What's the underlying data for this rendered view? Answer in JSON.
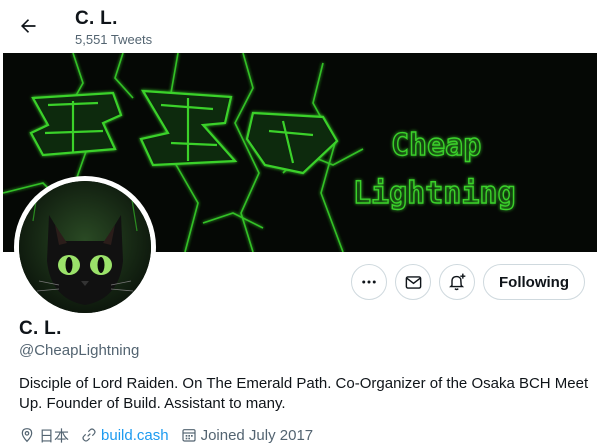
{
  "header": {
    "back_icon": "arrow-left-icon",
    "name": "C. L.",
    "tweet_count": "5,551 Tweets"
  },
  "banner": {
    "text_line1": "Cheap",
    "text_line2": "Lightning",
    "colors": {
      "background": "#050805",
      "lightning": "#39d62a",
      "text": "#3ad12b"
    }
  },
  "avatar": {
    "icon": "black-cat-avatar"
  },
  "actions": {
    "more_icon": "ellipsis-icon",
    "message_icon": "mail-icon",
    "notify_icon": "bell-plus-icon",
    "following_label": "Following"
  },
  "profile": {
    "display_name": "C. L.",
    "handle": "@CheapLightning",
    "bio": "Disciple of Lord Raiden. On The Emerald Path. Co-Organizer of the Osaka BCH Meet Up. Founder of Build. Assistant to many.",
    "location": "日本",
    "website": "build.cash",
    "joined": "Joined July 2017"
  },
  "colors": {
    "text": "#0f1419",
    "secondary": "#536471",
    "link": "#1d9bf0",
    "border": "#cfd9de"
  }
}
